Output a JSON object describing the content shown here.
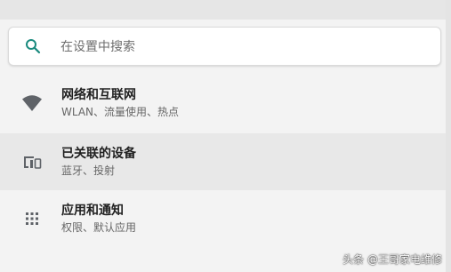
{
  "search": {
    "placeholder": "在设置中搜索",
    "icon": "search-icon",
    "accent_color": "#1a8a7e"
  },
  "settings": [
    {
      "title": "网络和互联网",
      "subtitle": "WLAN、流量使用、热点",
      "icon": "wifi-icon",
      "highlighted": false
    },
    {
      "title": "已关联的设备",
      "subtitle": "蓝牙、投射",
      "icon": "connected-devices-icon",
      "highlighted": true
    },
    {
      "title": "应用和通知",
      "subtitle": "权限、默认应用",
      "icon": "apps-grid-icon",
      "highlighted": false
    }
  ],
  "watermark": {
    "text": "头条 @王哥家电维修"
  }
}
